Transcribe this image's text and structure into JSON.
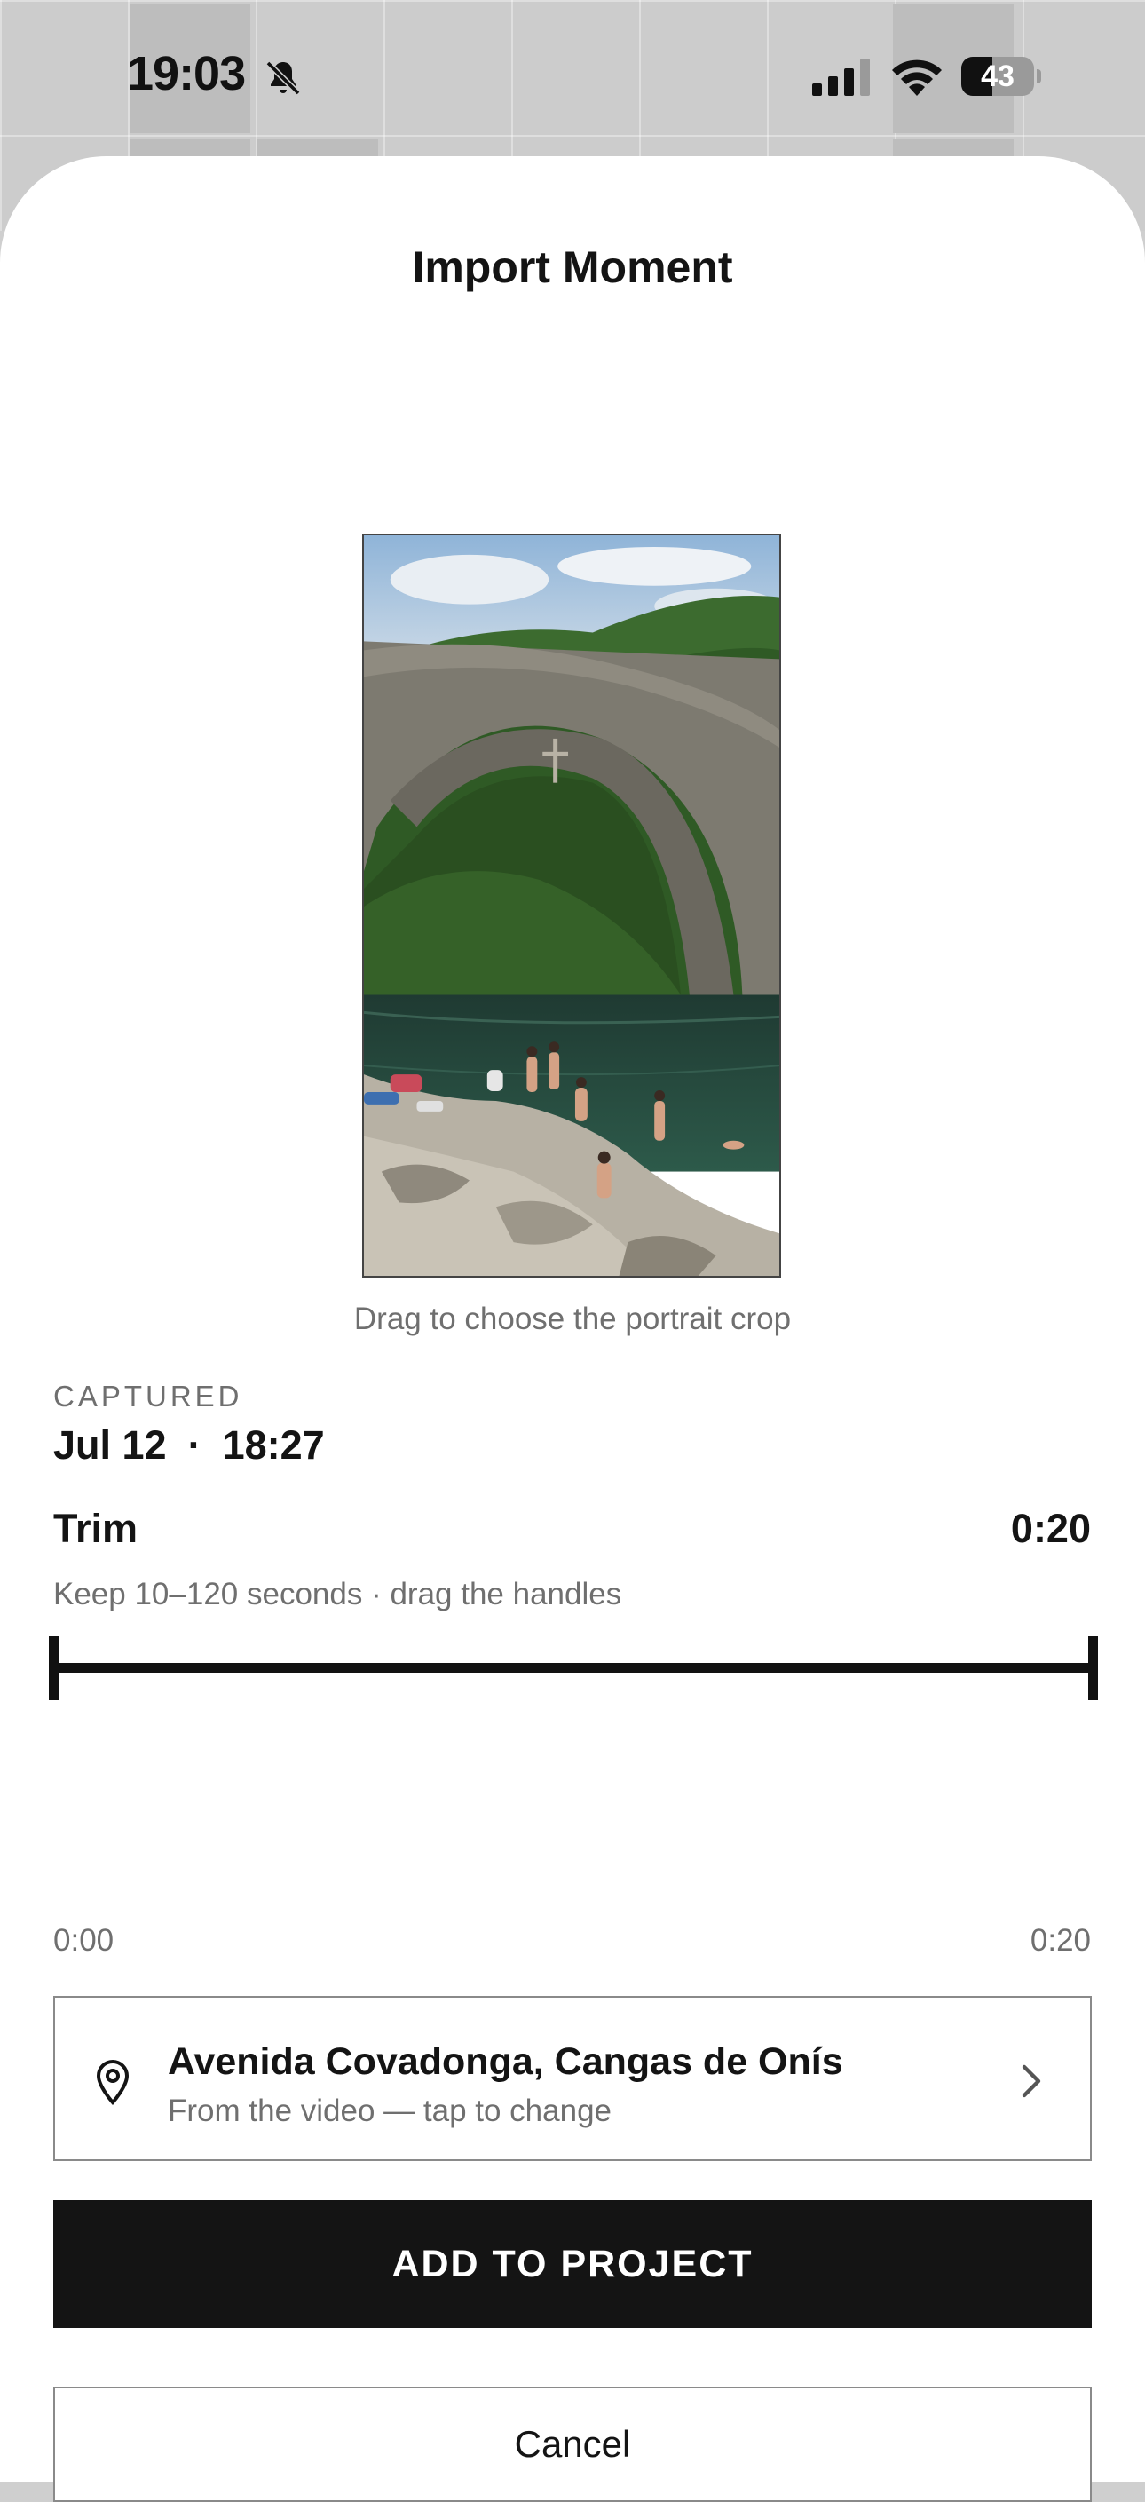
{
  "status_bar": {
    "time": "19:03",
    "battery_percent": "43",
    "battery_level": 0.43,
    "icons": [
      "bell-slash-icon",
      "cellular-signal-icon",
      "wifi-icon",
      "battery-icon"
    ]
  },
  "sheet": {
    "title": "Import Moment",
    "preview_hint": "Drag to choose the portrait crop"
  },
  "captured": {
    "label": "CAPTURED",
    "date": "Jul 12",
    "separator": "·",
    "time": "18:27"
  },
  "trim": {
    "title": "Trim",
    "duration": "0:20",
    "hint": "Keep 10–120 seconds · drag the handles",
    "start_label": "0:00",
    "end_label": "0:20",
    "start_fraction": 0,
    "end_fraction": 1
  },
  "location": {
    "title": "Avenida Covadonga, Cangas de Onís",
    "subtitle": "From the video — tap to change",
    "icon": "map-pin-icon",
    "chevron": "chevron-right-icon"
  },
  "actions": {
    "add_label": "ADD TO PROJECT",
    "cancel_label": "Cancel"
  },
  "colors": {
    "primary": "#141414",
    "muted_text": "#6f6f6f",
    "sheet_bg": "#ffffff"
  }
}
